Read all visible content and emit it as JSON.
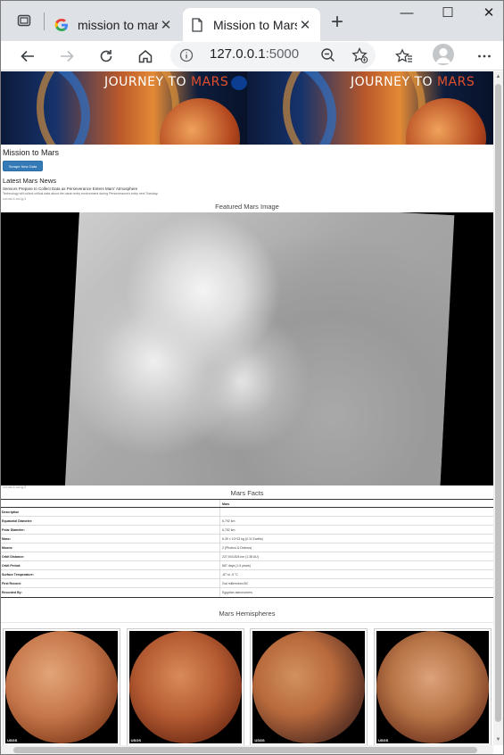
{
  "browser": {
    "tabs": [
      {
        "title": "mission to mars",
        "favicon": "google-g-icon",
        "active": false
      },
      {
        "title": "Mission to Mars",
        "favicon": "page-icon",
        "active": true
      }
    ],
    "url_host": "127.0.0.1",
    "url_port": ":5000",
    "window_controls": {
      "minimize": "—",
      "maximize": "☐",
      "close": "✕"
    },
    "new_tab": "+",
    "tab_close": "✕"
  },
  "banner": {
    "title_prefix": "JOURNEY TO ",
    "title_accent": "MARS"
  },
  "page": {
    "title": "Mission to Mars",
    "scrape_button": "Scrape New Data"
  },
  "news": {
    "heading": "Latest Mars News",
    "title": "Sensors Prepare to Collect Data as Perseverance Enters Mars' Atmosphere",
    "teaser": "Technology will collect critical data about the harsh entry environment during Perseverance's entry next Tuesday.",
    "column_label": "col-md-4 col-lg-3"
  },
  "featured": {
    "heading": "Featured Mars Image",
    "caption": "col-md-4 col-lg-3"
  },
  "facts": {
    "heading": "Mars Facts",
    "header": {
      "key": "",
      "value": "Mars"
    },
    "rows": [
      {
        "key": "Description",
        "value": ""
      },
      {
        "key": "Equatorial Diameter:",
        "value": "6,792 km"
      },
      {
        "key": "Polar Diameter:",
        "value": "6,752 km"
      },
      {
        "key": "Mass:",
        "value": "6.39 × 10^23 kg (0.11 Earths)"
      },
      {
        "key": "Moons:",
        "value": "2 (Phobos & Deimos)"
      },
      {
        "key": "Orbit Distance:",
        "value": "227,943,824 km (1.38 AU)"
      },
      {
        "key": "Orbit Period:",
        "value": "687 days (1.9 years)"
      },
      {
        "key": "Surface Temperature:",
        "value": "-87 to -5 °C"
      },
      {
        "key": "First Record:",
        "value": "2nd millennium BC"
      },
      {
        "key": "Recorded By:",
        "value": "Egyptian astronomers"
      }
    ]
  },
  "hemispheres": {
    "heading": "Mars Hemispheres",
    "watermark": "USGS"
  }
}
